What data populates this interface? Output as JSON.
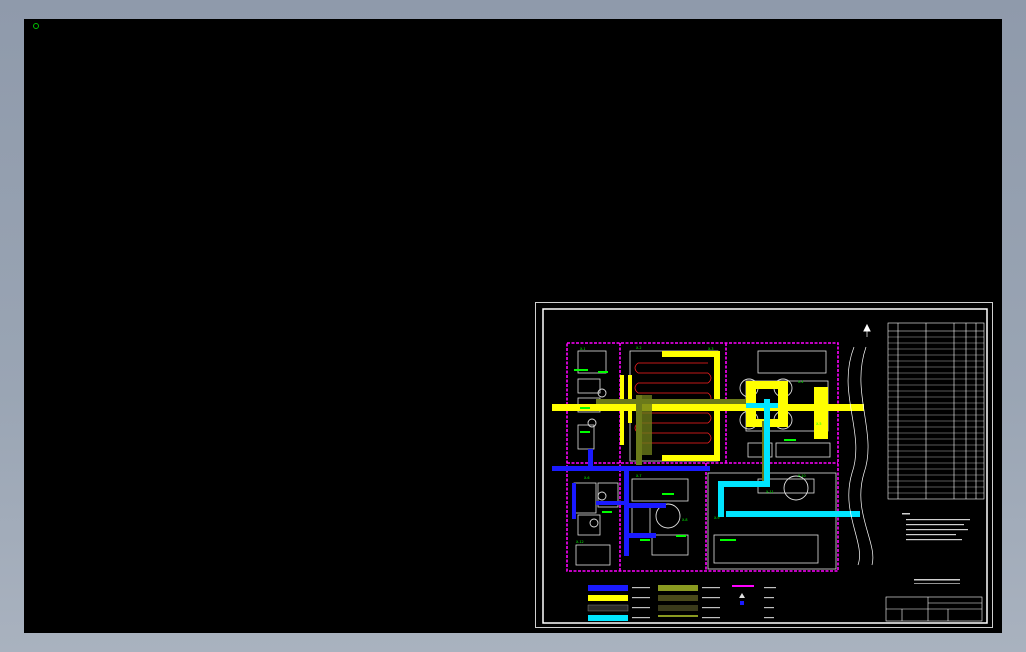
{
  "colors": {
    "background": "#000000",
    "frame": "#ffffff",
    "boundary": "#ff00ff",
    "pipe_sewage": "#1010ff",
    "pipe_yellow": "#ffff00",
    "pipe_olive": "#707a1a",
    "pipe_cyan": "#00e5ff",
    "annotation": "#00ff00"
  },
  "icons": [
    "ucs-marker-icon",
    "north-arrow-icon"
  ]
}
